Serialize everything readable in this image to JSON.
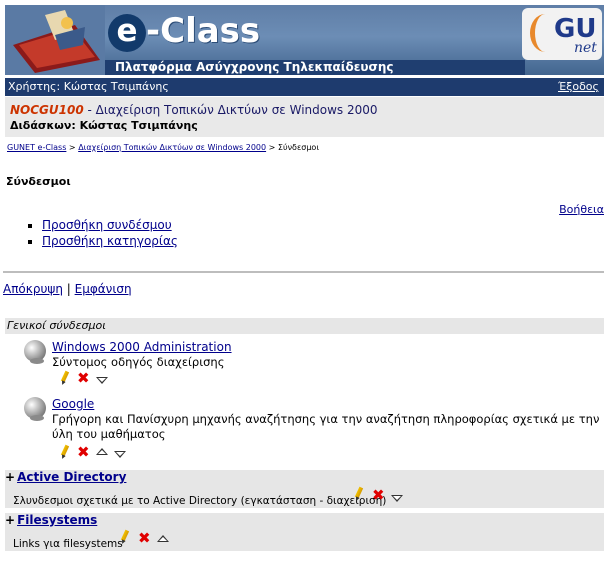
{
  "banner": {
    "logo_e": "e",
    "logo_class": "-Class",
    "subtitle": "Πλατφόρμα Ασύγχρονης Τηλεκπαίδευσης",
    "gunet_gu": "GU",
    "gunet_net": "net"
  },
  "userbar": {
    "user": "Χρήστης: Κώστας Τσιμπάνης",
    "logout": "Έξοδος"
  },
  "course": {
    "code": "NOCGU100",
    "title": " - Διαχείριση Τοπικών Δικτύων σε Windows 2000",
    "instructor": "Διδάσκων: Κώστας Τσιμπάνης"
  },
  "breadcrumb": {
    "home": "GUNET e-Class",
    "sep1": " > ",
    "course": "Διαχείριση Τοπικών Δικτύων σε Windows 2000",
    "sep2": " > ",
    "current": "Σύνδεσμοι"
  },
  "page_title": "Σύνδεσμοι",
  "help": "Βοήθεια",
  "actions": [
    "Προσθήκη συνδέσμου",
    "Προσθήκη κατηγορίας"
  ],
  "toggle": {
    "hide": "Απόκρυψη",
    "sep": " | ",
    "show": "Εμφάνιση"
  },
  "general": {
    "header": "Γενικοί σύνδεσμοι",
    "links": [
      {
        "title": "Windows 2000 Administration",
        "desc": "Σύντομος οδηγός διαχείρισης"
      },
      {
        "title": "Google",
        "desc": "Γρήγορη και Πανίσχυρη μηχανής αναζήτησης για την αναζήτηση πληροφορίας σχετικά με την ύλη του μαθήματος"
      }
    ]
  },
  "categories": [
    {
      "plus": "+",
      "title": "Active Directory",
      "desc": "Σλυνδεσμοι σχετικά με το Active Directory (εγκατάσταση - διαχείριση)"
    },
    {
      "plus": "+",
      "title": "Filesystems",
      "desc": "Links για filesystems"
    }
  ],
  "icons": {
    "edit": "pencil-icon",
    "delete": "delete-x-icon",
    "move_up": "move-up-icon",
    "move_down": "move-down-icon",
    "link": "globe-icon"
  },
  "colors": {
    "header_bar": "#1e3b6e",
    "link": "#00008b",
    "course_code": "#cc3300",
    "delete": "#e00000",
    "section_bg": "#e6e6e6"
  }
}
